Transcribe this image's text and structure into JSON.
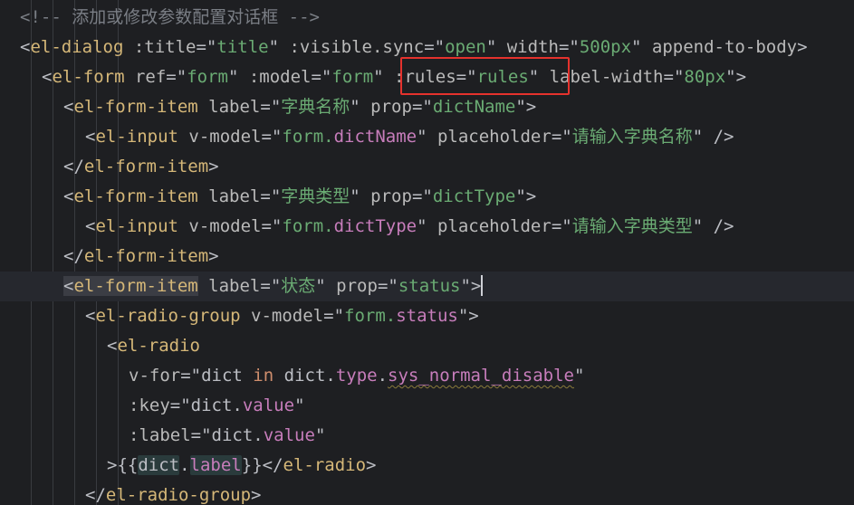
{
  "editor": {
    "language": "vue-template",
    "highlight_box_color": "#e5322d",
    "lines": [
      {
        "indent": 0,
        "tokens": [
          {
            "t": "comment",
            "v": "<!-- 添加或修改参数配置对话框 -->"
          }
        ]
      },
      {
        "indent": 0,
        "tokens": [
          {
            "t": "punc",
            "v": "<"
          },
          {
            "t": "tag",
            "v": "el-dialog"
          },
          {
            "t": "attr",
            "v": " :title"
          },
          {
            "t": "punc",
            "v": "=\""
          },
          {
            "t": "vue",
            "v": "title"
          },
          {
            "t": "punc",
            "v": "\""
          },
          {
            "t": "attr",
            "v": " :visible.sync"
          },
          {
            "t": "punc",
            "v": "=\""
          },
          {
            "t": "vue",
            "v": "open"
          },
          {
            "t": "punc",
            "v": "\""
          },
          {
            "t": "attr",
            "v": " width"
          },
          {
            "t": "punc",
            "v": "=\""
          },
          {
            "t": "str",
            "v": "500px"
          },
          {
            "t": "punc",
            "v": "\""
          },
          {
            "t": "attr",
            "v": " append-to-body"
          },
          {
            "t": "punc",
            "v": ">"
          }
        ]
      },
      {
        "indent": 1,
        "tokens": [
          {
            "t": "punc",
            "v": "<"
          },
          {
            "t": "tag",
            "v": "el-form"
          },
          {
            "t": "attr",
            "v": " ref"
          },
          {
            "t": "punc",
            "v": "=\""
          },
          {
            "t": "str",
            "v": "form"
          },
          {
            "t": "punc",
            "v": "\""
          },
          {
            "t": "attr",
            "v": " :model"
          },
          {
            "t": "punc",
            "v": "=\""
          },
          {
            "t": "vue",
            "v": "form"
          },
          {
            "t": "punc",
            "v": "\""
          },
          {
            "t": "attr",
            "v": " :rules"
          },
          {
            "t": "punc",
            "v": "=\""
          },
          {
            "t": "vue",
            "v": "rules"
          },
          {
            "t": "punc",
            "v": "\""
          },
          {
            "t": "attr",
            "v": " label-width"
          },
          {
            "t": "punc",
            "v": "=\""
          },
          {
            "t": "str",
            "v": "80px"
          },
          {
            "t": "punc",
            "v": "\">"
          }
        ]
      },
      {
        "indent": 2,
        "tokens": [
          {
            "t": "punc",
            "v": "<"
          },
          {
            "t": "tag",
            "v": "el-form-item"
          },
          {
            "t": "attr",
            "v": " label"
          },
          {
            "t": "punc",
            "v": "=\""
          },
          {
            "t": "str",
            "v": "字典名称"
          },
          {
            "t": "punc",
            "v": "\""
          },
          {
            "t": "attr",
            "v": " prop"
          },
          {
            "t": "punc",
            "v": "=\""
          },
          {
            "t": "str",
            "v": "dictName"
          },
          {
            "t": "punc",
            "v": "\">"
          }
        ]
      },
      {
        "indent": 3,
        "tokens": [
          {
            "t": "punc",
            "v": "<"
          },
          {
            "t": "tag",
            "v": "el-input"
          },
          {
            "t": "attr",
            "v": " v-model"
          },
          {
            "t": "punc",
            "v": "=\""
          },
          {
            "t": "vue",
            "v": "form."
          },
          {
            "t": "prop",
            "v": "dictName"
          },
          {
            "t": "punc",
            "v": "\""
          },
          {
            "t": "attr",
            "v": " placeholder"
          },
          {
            "t": "punc",
            "v": "=\""
          },
          {
            "t": "str",
            "v": "请输入字典名称"
          },
          {
            "t": "punc",
            "v": "\" />"
          }
        ]
      },
      {
        "indent": 2,
        "tokens": [
          {
            "t": "punc",
            "v": "</"
          },
          {
            "t": "tag",
            "v": "el-form-item"
          },
          {
            "t": "punc",
            "v": ">"
          }
        ]
      },
      {
        "indent": 2,
        "tokens": [
          {
            "t": "punc",
            "v": "<"
          },
          {
            "t": "tag",
            "v": "el-form-item"
          },
          {
            "t": "attr",
            "v": " label"
          },
          {
            "t": "punc",
            "v": "=\""
          },
          {
            "t": "str",
            "v": "字典类型"
          },
          {
            "t": "punc",
            "v": "\""
          },
          {
            "t": "attr",
            "v": " prop"
          },
          {
            "t": "punc",
            "v": "=\""
          },
          {
            "t": "str",
            "v": "dictType"
          },
          {
            "t": "punc",
            "v": "\">"
          }
        ]
      },
      {
        "indent": 3,
        "tokens": [
          {
            "t": "punc",
            "v": "<"
          },
          {
            "t": "tag",
            "v": "el-input"
          },
          {
            "t": "attr",
            "v": " v-model"
          },
          {
            "t": "punc",
            "v": "=\""
          },
          {
            "t": "vue",
            "v": "form."
          },
          {
            "t": "prop",
            "v": "dictType"
          },
          {
            "t": "punc",
            "v": "\""
          },
          {
            "t": "attr",
            "v": " placeholder"
          },
          {
            "t": "punc",
            "v": "=\""
          },
          {
            "t": "str",
            "v": "请输入字典类型"
          },
          {
            "t": "punc",
            "v": "\" />"
          }
        ]
      },
      {
        "indent": 2,
        "tokens": [
          {
            "t": "punc",
            "v": "</"
          },
          {
            "t": "tag",
            "v": "el-form-item"
          },
          {
            "t": "punc",
            "v": ">"
          }
        ]
      },
      {
        "indent": 2,
        "current": true,
        "tokens": [
          {
            "t": "punc match",
            "v": "<"
          },
          {
            "t": "tag match",
            "v": "el-form-item"
          },
          {
            "t": "attr",
            "v": " label"
          },
          {
            "t": "punc",
            "v": "=\""
          },
          {
            "t": "str",
            "v": "状态"
          },
          {
            "t": "punc",
            "v": "\""
          },
          {
            "t": "attr",
            "v": " prop"
          },
          {
            "t": "punc",
            "v": "=\""
          },
          {
            "t": "str",
            "v": "status"
          },
          {
            "t": "punc",
            "v": "\">"
          },
          {
            "t": "caret",
            "v": ""
          }
        ]
      },
      {
        "indent": 3,
        "tokens": [
          {
            "t": "punc",
            "v": "<"
          },
          {
            "t": "tag",
            "v": "el-radio-group"
          },
          {
            "t": "attr",
            "v": " v-model"
          },
          {
            "t": "punc",
            "v": "=\""
          },
          {
            "t": "vue",
            "v": "form."
          },
          {
            "t": "prop",
            "v": "status"
          },
          {
            "t": "punc",
            "v": "\">"
          }
        ]
      },
      {
        "indent": 4,
        "tokens": [
          {
            "t": "punc",
            "v": "<"
          },
          {
            "t": "tag",
            "v": "el-radio"
          }
        ]
      },
      {
        "indent": 5,
        "tokens": [
          {
            "t": "attr",
            "v": "v-for"
          },
          {
            "t": "punc",
            "v": "=\""
          },
          {
            "t": "ident",
            "v": "dict "
          },
          {
            "t": "kw",
            "v": "in"
          },
          {
            "t": "ident",
            "v": " dict."
          },
          {
            "t": "prop",
            "v": "type"
          },
          {
            "t": "ident",
            "v": "."
          },
          {
            "t": "prop squiggle",
            "v": "sys_normal_disable"
          },
          {
            "t": "punc",
            "v": "\""
          }
        ]
      },
      {
        "indent": 5,
        "tokens": [
          {
            "t": "attr",
            "v": ":key"
          },
          {
            "t": "punc",
            "v": "=\""
          },
          {
            "t": "ident",
            "v": "dict."
          },
          {
            "t": "prop",
            "v": "value"
          },
          {
            "t": "punc",
            "v": "\""
          }
        ]
      },
      {
        "indent": 5,
        "tokens": [
          {
            "t": "attr",
            "v": ":label"
          },
          {
            "t": "punc",
            "v": "=\""
          },
          {
            "t": "ident",
            "v": "dict."
          },
          {
            "t": "prop",
            "v": "value"
          },
          {
            "t": "punc",
            "v": "\""
          }
        ]
      },
      {
        "indent": 4,
        "tokens": [
          {
            "t": "punc",
            "v": ">{{"
          },
          {
            "t": "ident hl-ref",
            "v": "dict"
          },
          {
            "t": "ident",
            "v": "."
          },
          {
            "t": "prop hl-ref",
            "v": "label"
          },
          {
            "t": "punc",
            "v": "}}</"
          },
          {
            "t": "tag",
            "v": "el-radio"
          },
          {
            "t": "punc",
            "v": ">"
          }
        ]
      },
      {
        "indent": 3,
        "tokens": [
          {
            "t": "punc",
            "v": "</"
          },
          {
            "t": "tag",
            "v": "el-radio-group"
          },
          {
            "t": "punc",
            "v": ">"
          }
        ]
      }
    ]
  }
}
